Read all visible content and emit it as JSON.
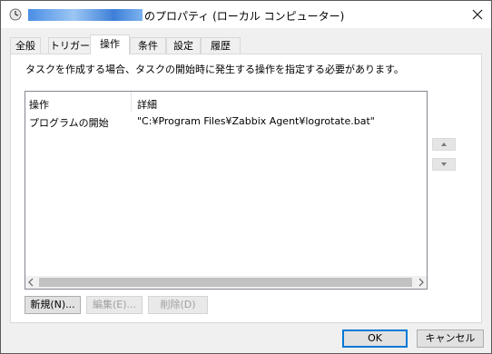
{
  "window": {
    "title_suffix": "のプロパティ (ローカル コンピューター)"
  },
  "tabs": [
    {
      "label": "全般"
    },
    {
      "label": "トリガー"
    },
    {
      "label": "操作"
    },
    {
      "label": "条件"
    },
    {
      "label": "設定"
    },
    {
      "label": "履歴"
    }
  ],
  "active_tab": "操作",
  "actions_page": {
    "instruction": "タスクを作成する場合、タスクの開始時に発生する操作を指定する必要があります。",
    "columns": {
      "action": "操作",
      "details": "詳細"
    },
    "rows": [
      {
        "action": "プログラムの開始",
        "details": "\"C:¥Program Files¥Zabbix Agent¥logrotate.bat\""
      }
    ],
    "buttons": {
      "new": "新規(N)...",
      "edit": "編集(E)...",
      "delete": "削除(D)"
    }
  },
  "footer": {
    "ok": "OK",
    "cancel": "キャンセル"
  },
  "icons": {
    "title": "clock-icon",
    "close": "close-icon",
    "move_up": "arrow-up-icon",
    "move_down": "arrow-down-icon",
    "scroll_left": "scroll-left-icon",
    "scroll_right": "scroll-right-icon"
  },
  "colors": {
    "accent": "#0078d7",
    "selected_tab_bg": "#ffffff",
    "window_bg": "#f0f0f0"
  }
}
